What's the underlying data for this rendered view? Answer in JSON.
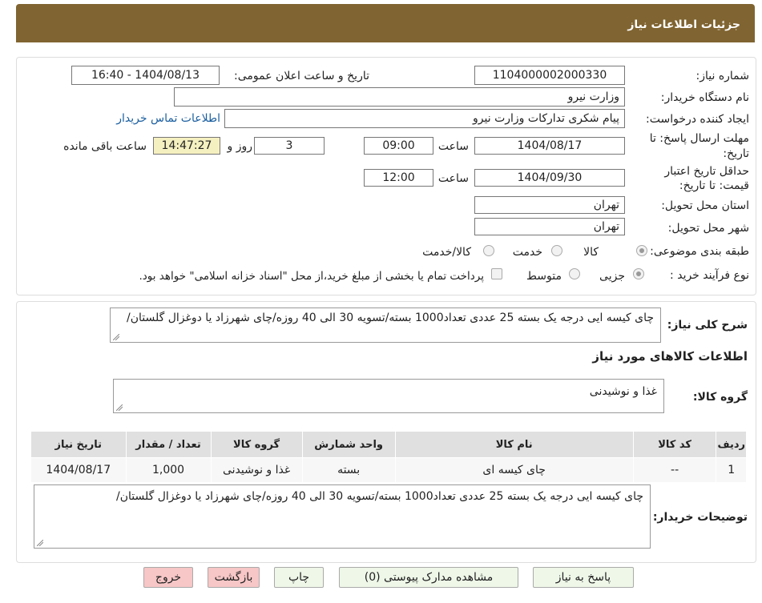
{
  "header": {
    "title": "جزئیات اطلاعات نیاز"
  },
  "fields": {
    "need_number_label": "شماره نیاز:",
    "need_number": "1104000002000330",
    "announce_label": "تاریخ و ساعت اعلان عمومی:",
    "announce_value": "1404/08/13 - 16:40",
    "buyer_org_label": "نام دستگاه خریدار:",
    "buyer_org": "وزارت نیرو",
    "requester_label": "ایجاد کننده درخواست:",
    "requester": "پیام شکری تدارکات وزارت نیرو",
    "contact_link": "اطلاعات تماس خریدار",
    "deadline_label_1": "مهلت ارسال پاسخ: تا",
    "deadline_label_2": "تاریخ:",
    "deadline_date": "1404/08/17",
    "time_label": "ساعت",
    "deadline_time": "09:00",
    "days_value": "3",
    "days_label": "روز و",
    "remaining_time": "14:47:27",
    "remaining_label": "ساعت باقی مانده",
    "validity_label_1": "حداقل تاریخ اعتبار",
    "validity_label_2": "قیمت: تا تاریخ:",
    "validity_date": "1404/09/30",
    "validity_time": "12:00",
    "province_label": "استان محل تحویل:",
    "province": "تهران",
    "city_label": "شهر محل تحویل:",
    "city": "تهران",
    "category_label": "طبقه بندی موضوعی:",
    "category_options": [
      "کالا",
      "خدمت",
      "کالا/خدمت"
    ],
    "process_label": "نوع فرآیند خرید :",
    "process_options": [
      "جزیی",
      "متوسط"
    ],
    "payment_note": "پرداخت تمام یا بخشی از مبلغ خرید،از محل \"اسناد خزانه اسلامی\" خواهد بود."
  },
  "description": {
    "label": "شرح کلی نیاز:",
    "text": "چای کیسه ایی درجه یک بسته 25 عددی تعداد1000 بسته/تسویه 30 الی 40 روزه/چای شهرزاد یا دوغزال گلستان/"
  },
  "goods": {
    "section_title": "اطلاعات کالاهای مورد نیاز",
    "group_label": "گروه کالا:",
    "group_value": "غذا و نوشیدنی",
    "columns": [
      "ردیف",
      "کد کالا",
      "نام کالا",
      "واحد شمارش",
      "گروه کالا",
      "تعداد / مقدار",
      "تاریخ نیاز"
    ],
    "rows": [
      [
        "1",
        "--",
        "چای کیسه ای",
        "بسته",
        "غذا و نوشیدنی",
        "1,000",
        "1404/08/17"
      ]
    ]
  },
  "buyer_notes": {
    "label": "توضیحات خریدار:",
    "text": "چای کیسه ایی درجه یک بسته 25 عددی تعداد1000 بسته/تسویه 30 الی 40 روزه/چای شهرزاد یا دوغزال گلستان/"
  },
  "buttons": {
    "reply": "پاسخ به نیاز",
    "attachments": "مشاهده مدارک پیوستی (0)",
    "print": "چاپ",
    "back": "بازگشت",
    "exit": "خروج"
  },
  "colors": {
    "header_bg": "#806431",
    "button_bg": "#eef7e8",
    "button_pink": "#f7c6c6",
    "remaining_bg": "#f5f0c0"
  }
}
